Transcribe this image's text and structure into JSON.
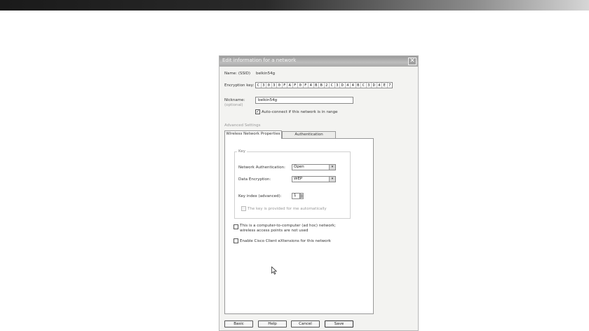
{
  "dialog": {
    "title": "Edit information for a network",
    "close_glyph": "✕",
    "name_label": "Name: (SSID)",
    "name_value": "belkin54g",
    "encryption_label": "Encryption key:",
    "encryption_key": [
      "C",
      "3",
      "0",
      "3",
      "0",
      "F",
      "A",
      "F",
      "0",
      "F",
      "4",
      "B",
      "B",
      "2",
      "C",
      "3",
      "D",
      "4",
      "4",
      "B",
      "C",
      "3",
      "D",
      "4",
      "E",
      "7"
    ],
    "nickname_label": "Nickname:",
    "optional_label": "(optional)",
    "nickname_value": "belkin54g",
    "autoconnect_label": "Auto-connect if this network is in range",
    "autoconnect_checked": "✓",
    "advanced_label": "Advanced Settings",
    "tabs": [
      {
        "label": "Wireless Network Properties"
      },
      {
        "label": "Authentication"
      }
    ],
    "key_group": {
      "title": "Key",
      "auth_label": "Network Authentication:",
      "auth_value": "Open",
      "encryption_label": "Data Encryption:",
      "encryption_value": "WEP",
      "key_index_label": "Key index (advanced):",
      "key_index_value": "1",
      "auto_key_label": "The key is provided for me automatically"
    },
    "adhoc_label_1": "This is a computer-to-computer (ad hoc) network;",
    "adhoc_label_2": "wireless access points are not used",
    "cisco_label": "Enable Cisco Client eXtensions for this network",
    "buttons": {
      "basic": "Basic",
      "help": "Help",
      "cancel": "Cancel",
      "save": "Save"
    },
    "dropdown_glyph": "▾",
    "spin_up": "▴",
    "spin_down": "▾"
  }
}
